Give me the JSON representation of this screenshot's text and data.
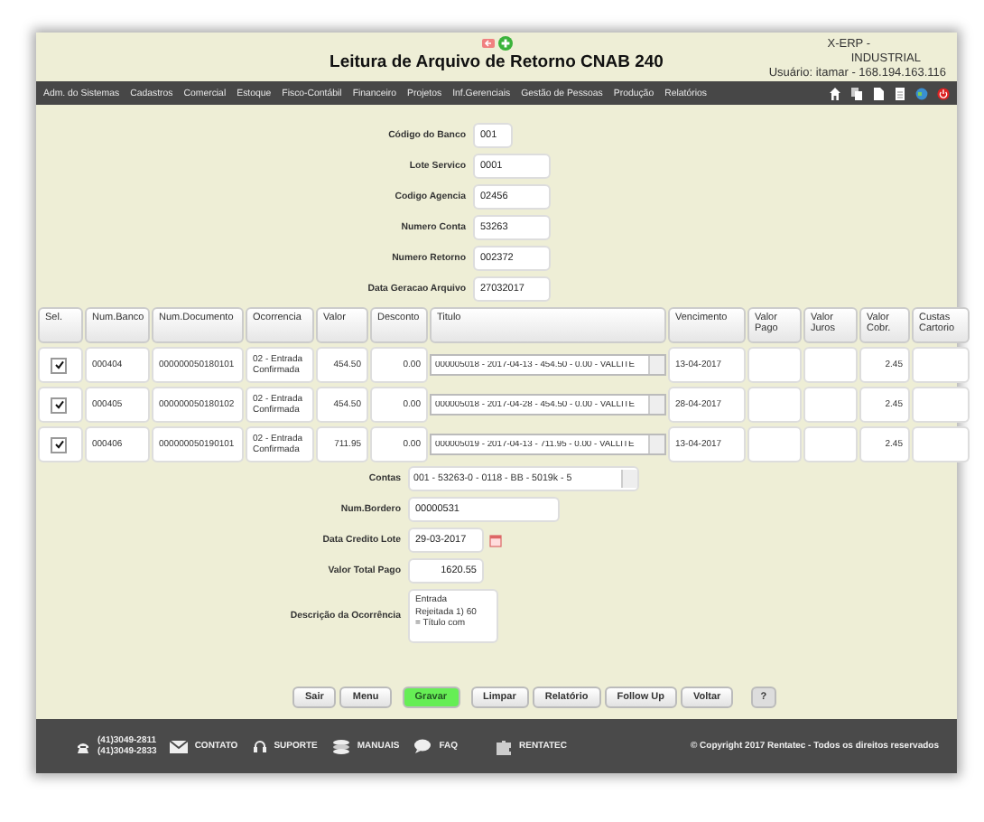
{
  "header": {
    "title": "Leitura de Arquivo de Retorno CNAB 240",
    "system": [
      "X-ERP -",
      "INDUSTRIAL"
    ],
    "user": "Usuário: itamar - 168.194.163.116"
  },
  "nav": {
    "items": [
      "Adm. do Sistemas",
      "Cadastros",
      "Comercial",
      "Estoque",
      "Fisco-Contábil",
      "Financeiro",
      "Projetos",
      "Inf.Gerenciais",
      "Gestão de Pessoas",
      "Produção",
      "Relatórios"
    ]
  },
  "top_form": [
    {
      "label": "Código do Banco",
      "value": "001"
    },
    {
      "label": "Lote Servico",
      "value": "0001"
    },
    {
      "label": "Codigo Agencia",
      "value": "02456"
    },
    {
      "label": "Numero Conta",
      "value": "53263"
    },
    {
      "label": "Numero Retorno",
      "value": "002372"
    },
    {
      "label": "Data Geracao Arquivo",
      "value": "27032017"
    }
  ],
  "table": {
    "columns": [
      "Sel.",
      "Num.Banco",
      "Num.Documento",
      "Ocorrencia",
      "Valor",
      "Desconto",
      "Titulo",
      "Vencimento",
      "Valor Pago",
      "Valor Juros",
      "Valor Cobr.",
      "Custas Cartorio"
    ],
    "rows": [
      {
        "checked": true,
        "num_banco": "000404",
        "num_documento": "000000050180101",
        "ocorrencia": "02 - Entrada Confirmada",
        "valor": "454.50",
        "desconto": "0.00",
        "titulo": "000005018 - 2017-04-13 - 454.50 - 0.00 - VALLITE",
        "vencimento": "13-04-2017",
        "valor_cobr": "2.45"
      },
      {
        "checked": true,
        "num_banco": "000405",
        "num_documento": "000000050180102",
        "ocorrencia": "02 - Entrada Confirmada",
        "valor": "454.50",
        "desconto": "0.00",
        "titulo": "000005018 - 2017-04-28 - 454.50 - 0.00 - VALLITE",
        "vencimento": "28-04-2017",
        "valor_cobr": "2.45"
      },
      {
        "checked": true,
        "num_banco": "000406",
        "num_documento": "000000050190101",
        "ocorrencia": "02 - Entrada Confirmada",
        "valor": "711.95",
        "desconto": "0.00",
        "titulo": "000005019 - 2017-04-13 - 711.95 - 0.00 - VALLITE",
        "vencimento": "13-04-2017",
        "valor_cobr": "2.45"
      }
    ]
  },
  "bottom_form": [
    {
      "kind": "select",
      "label": "Contas",
      "value": "001 - 53263-0 - 0118 - BB - 5019k - 5"
    },
    {
      "kind": "text",
      "label": "Num.Bordero",
      "value": "00000531"
    },
    {
      "kind": "date",
      "label": "Data Credito Lote",
      "value": "29-03-2017"
    },
    {
      "kind": "number",
      "label": "Valor Total Pago",
      "value": "1620.55"
    },
    {
      "kind": "textarea",
      "label": "Descrição da Ocorrência",
      "value": "Entrada Rejeitada 1) 60 = Título com"
    }
  ],
  "buttons": [
    {
      "label": "Sair",
      "kind": "default"
    },
    {
      "label": "Menu",
      "kind": "default"
    },
    {
      "label": "Gravar",
      "kind": "primary"
    },
    {
      "label": "Limpar",
      "kind": "default"
    },
    {
      "label": "Relatório",
      "kind": "default"
    },
    {
      "label": "Follow Up",
      "kind": "default"
    },
    {
      "label": "Voltar",
      "kind": "default"
    },
    {
      "label": "?",
      "kind": "help"
    }
  ],
  "footer": {
    "phones": [
      "(41)3049-2811",
      "(41)3049-2833"
    ],
    "contato": "CONTATO",
    "suporte": "SUPORTE",
    "manuais": "MANUAIS",
    "faq": "FAQ",
    "rentatec": "RENTATEC",
    "copyright": "© Copyright 2017 Rentatec - Todos os direitos reservados"
  }
}
